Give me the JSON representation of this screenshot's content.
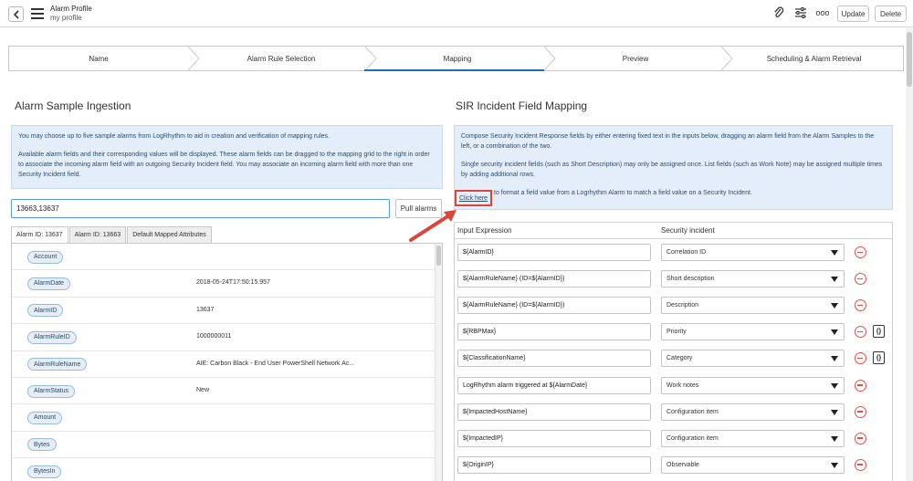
{
  "header": {
    "title": "Alarm Profile",
    "subtitle": "my profile",
    "icons": [
      "paperclip-icon",
      "sliders-icon",
      "more-icon"
    ],
    "more_label": "ooo",
    "update_label": "Update",
    "delete_label": "Delete"
  },
  "wizard": {
    "steps": [
      "Name",
      "Alarm Rule Selection",
      "Mapping",
      "Preview",
      "Scheduling & Alarm Retrieval"
    ],
    "active": "Mapping"
  },
  "left": {
    "title": "Alarm Sample Ingestion",
    "info_p1": "You may choose up to five sample alarms from LogRhythm to aid in creation and verification of mapping rules.",
    "info_p2": "Available alarm fields and their corresponding values will be displayed. These alarm fields can be dragged to the mapping grid to the right in order to associate the incoming alarm field with an outgoing Security Incident field. You may associate an incoming alarm field with more than one Security Incident field.",
    "alarm_ids_value": "13663,13637",
    "pull_button": "Pull alarms",
    "tabs": [
      "Alarm ID: 13637",
      "Alarm ID: 13663",
      "Default Mapped Attributes"
    ],
    "rows": [
      {
        "field": "Account",
        "value": ""
      },
      {
        "field": "AlarmDate",
        "value": "2018-05-24T17:50:15.957"
      },
      {
        "field": "AlarmID",
        "value": "13637"
      },
      {
        "field": "AlarmRuleID",
        "value": "1000000011"
      },
      {
        "field": "AlarmRuleName",
        "value": "AIE: Carbon Black - End User PowerShell Network Ac..."
      },
      {
        "field": "AlarmStatus",
        "value": "New"
      },
      {
        "field": "Amount",
        "value": ""
      },
      {
        "field": "Bytes",
        "value": ""
      },
      {
        "field": "BytesIn",
        "value": ""
      }
    ]
  },
  "right": {
    "title": "SIR Incident Field Mapping",
    "info_p1": "Compose Security Incident Response fields by either entering fixed text in the inputs below, dragging an alarm field from the Alarm Samples to the left, or a combination of the two.",
    "info_p2": "Single security incident fields (such as Short Description) may only be assigned once. List fields (such as Work Note) may be assigned multiple times by adding additional rows.",
    "click_here": "Click here",
    "info_p3": " to format a field value from a Logrhythm Alarm to match a field value on a Security Incident.",
    "col_input": "Input Expression",
    "col_incident": "Security incident",
    "script_label": "{}",
    "rows": [
      {
        "expr": "${AlarmID}",
        "field": "Correlation ID",
        "script": false
      },
      {
        "expr": "${AlarmRuleName} (ID=${AlarmID})",
        "field": "Short description",
        "script": false
      },
      {
        "expr": "${AlarmRuleName} (ID=${AlarmID})",
        "field": "Description",
        "script": false
      },
      {
        "expr": "${RBPMax}",
        "field": "Priority",
        "script": true
      },
      {
        "expr": "${ClassificationName}",
        "field": "Category",
        "script": true
      },
      {
        "expr": "LogRhythm alarm triggered at ${AlarmDate}",
        "field": "Work notes",
        "script": false
      },
      {
        "expr": "${ImpactedHostName}",
        "field": "Configuration item",
        "script": false
      },
      {
        "expr": "${ImpactedIP}",
        "field": "Configuration item",
        "script": false
      },
      {
        "expr": "${OriginIP}",
        "field": "Observable",
        "script": false
      }
    ]
  },
  "colors": {
    "accent": "#1f6fb5",
    "info_bg": "#e3eefa",
    "delete_red": "#e05247",
    "annotation_red": "#d9463b"
  }
}
